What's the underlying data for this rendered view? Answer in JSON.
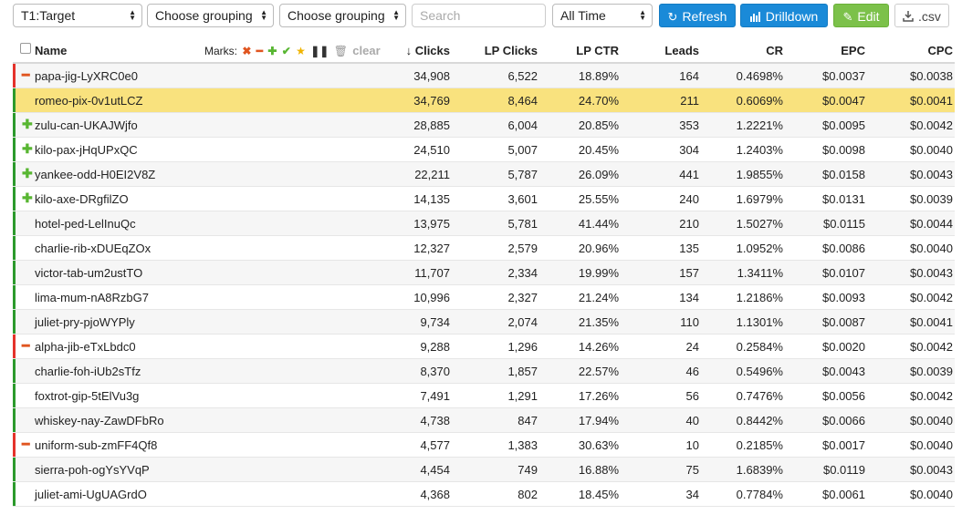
{
  "toolbar": {
    "target_select": "T1:Target",
    "grouping1": "Choose grouping",
    "grouping2": "Choose grouping",
    "search_placeholder": "Search",
    "time_select": "All Time",
    "refresh_label": "Refresh",
    "drilldown_label": "Drilldown",
    "edit_label": "Edit",
    "csv_label": ".csv"
  },
  "header": {
    "name": "Name",
    "marks_label": "Marks:",
    "clear_label": "clear",
    "clicks": "Clicks",
    "lp_clicks": "LP Clicks",
    "lp_ctr": "LP CTR",
    "leads": "Leads",
    "cr": "CR",
    "epc": "EPC",
    "cpc": "CPC"
  },
  "colors": {
    "accent_blue": "#1a8ad8",
    "edit_green": "#7cc14a",
    "mark_red": "#e4322b",
    "mark_green": "#2c9a2c",
    "highlight": "#f9e27e"
  },
  "rows": [
    {
      "name": "papa-jig-LyXRC0e0",
      "mark": "minus",
      "bar": "red",
      "highlight": false,
      "clicks": "34,908",
      "lp_clicks": "6,522",
      "lp_ctr": "18.89%",
      "leads": "164",
      "cr": "0.4698%",
      "epc": "$0.0037",
      "cpc": "$0.0038"
    },
    {
      "name": "romeo-pix-0v1utLCZ",
      "mark": "",
      "bar": "green",
      "highlight": true,
      "clicks": "34,769",
      "lp_clicks": "8,464",
      "lp_ctr": "24.70%",
      "leads": "211",
      "cr": "0.6069%",
      "epc": "$0.0047",
      "cpc": "$0.0041"
    },
    {
      "name": "zulu-can-UKAJWjfo",
      "mark": "plus",
      "bar": "green",
      "highlight": false,
      "clicks": "28,885",
      "lp_clicks": "6,004",
      "lp_ctr": "20.85%",
      "leads": "353",
      "cr": "1.2221%",
      "epc": "$0.0095",
      "cpc": "$0.0042"
    },
    {
      "name": "kilo-pax-jHqUPxQC",
      "mark": "plus",
      "bar": "green",
      "highlight": false,
      "clicks": "24,510",
      "lp_clicks": "5,007",
      "lp_ctr": "20.45%",
      "leads": "304",
      "cr": "1.2403%",
      "epc": "$0.0098",
      "cpc": "$0.0040"
    },
    {
      "name": "yankee-odd-H0EI2V8Z",
      "mark": "plus",
      "bar": "green",
      "highlight": false,
      "clicks": "22,211",
      "lp_clicks": "5,787",
      "lp_ctr": "26.09%",
      "leads": "441",
      "cr": "1.9855%",
      "epc": "$0.0158",
      "cpc": "$0.0043"
    },
    {
      "name": "kilo-axe-DRgfilZO",
      "mark": "plus",
      "bar": "green",
      "highlight": false,
      "clicks": "14,135",
      "lp_clicks": "3,601",
      "lp_ctr": "25.55%",
      "leads": "240",
      "cr": "1.6979%",
      "epc": "$0.0131",
      "cpc": "$0.0039"
    },
    {
      "name": "hotel-ped-LelInuQc",
      "mark": "",
      "bar": "green",
      "highlight": false,
      "clicks": "13,975",
      "lp_clicks": "5,781",
      "lp_ctr": "41.44%",
      "leads": "210",
      "cr": "1.5027%",
      "epc": "$0.0115",
      "cpc": "$0.0044"
    },
    {
      "name": "charlie-rib-xDUEqZOx",
      "mark": "",
      "bar": "green",
      "highlight": false,
      "clicks": "12,327",
      "lp_clicks": "2,579",
      "lp_ctr": "20.96%",
      "leads": "135",
      "cr": "1.0952%",
      "epc": "$0.0086",
      "cpc": "$0.0040"
    },
    {
      "name": "victor-tab-um2ustTO",
      "mark": "",
      "bar": "green",
      "highlight": false,
      "clicks": "11,707",
      "lp_clicks": "2,334",
      "lp_ctr": "19.99%",
      "leads": "157",
      "cr": "1.3411%",
      "epc": "$0.0107",
      "cpc": "$0.0043"
    },
    {
      "name": "lima-mum-nA8RzbG7",
      "mark": "",
      "bar": "green",
      "highlight": false,
      "clicks": "10,996",
      "lp_clicks": "2,327",
      "lp_ctr": "21.24%",
      "leads": "134",
      "cr": "1.2186%",
      "epc": "$0.0093",
      "cpc": "$0.0042"
    },
    {
      "name": "juliet-pry-pjoWYPly",
      "mark": "",
      "bar": "green",
      "highlight": false,
      "clicks": "9,734",
      "lp_clicks": "2,074",
      "lp_ctr": "21.35%",
      "leads": "110",
      "cr": "1.1301%",
      "epc": "$0.0087",
      "cpc": "$0.0041"
    },
    {
      "name": "alpha-jib-eTxLbdc0",
      "mark": "minus",
      "bar": "red",
      "highlight": false,
      "clicks": "9,288",
      "lp_clicks": "1,296",
      "lp_ctr": "14.26%",
      "leads": "24",
      "cr": "0.2584%",
      "epc": "$0.0020",
      "cpc": "$0.0042"
    },
    {
      "name": "charlie-foh-iUb2sTfz",
      "mark": "",
      "bar": "green",
      "highlight": false,
      "clicks": "8,370",
      "lp_clicks": "1,857",
      "lp_ctr": "22.57%",
      "leads": "46",
      "cr": "0.5496%",
      "epc": "$0.0043",
      "cpc": "$0.0039"
    },
    {
      "name": "foxtrot-gip-5tElVu3g",
      "mark": "",
      "bar": "green",
      "highlight": false,
      "clicks": "7,491",
      "lp_clicks": "1,291",
      "lp_ctr": "17.26%",
      "leads": "56",
      "cr": "0.7476%",
      "epc": "$0.0056",
      "cpc": "$0.0042"
    },
    {
      "name": "whiskey-nay-ZawDFbRo",
      "mark": "",
      "bar": "green",
      "highlight": false,
      "clicks": "4,738",
      "lp_clicks": "847",
      "lp_ctr": "17.94%",
      "leads": "40",
      "cr": "0.8442%",
      "epc": "$0.0066",
      "cpc": "$0.0040"
    },
    {
      "name": "uniform-sub-zmFF4Qf8",
      "mark": "minus",
      "bar": "red",
      "highlight": false,
      "clicks": "4,577",
      "lp_clicks": "1,383",
      "lp_ctr": "30.63%",
      "leads": "10",
      "cr": "0.2185%",
      "epc": "$0.0017",
      "cpc": "$0.0040"
    },
    {
      "name": "sierra-poh-ogYsYVqP",
      "mark": "",
      "bar": "green",
      "highlight": false,
      "clicks": "4,454",
      "lp_clicks": "749",
      "lp_ctr": "16.88%",
      "leads": "75",
      "cr": "1.6839%",
      "epc": "$0.0119",
      "cpc": "$0.0043"
    },
    {
      "name": "juliet-ami-UgUAGrdO",
      "mark": "",
      "bar": "green",
      "highlight": false,
      "clicks": "4,368",
      "lp_clicks": "802",
      "lp_ctr": "18.45%",
      "leads": "34",
      "cr": "0.7784%",
      "epc": "$0.0061",
      "cpc": "$0.0040"
    }
  ]
}
